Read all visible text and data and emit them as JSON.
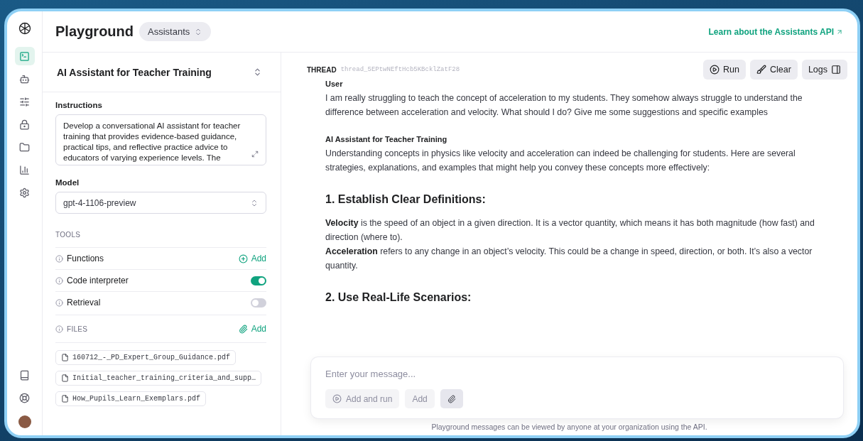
{
  "header": {
    "title": "Playground",
    "mode": "Assistants",
    "api_link": "Learn about the Assistants API"
  },
  "nav": [
    {
      "kind": "terminal",
      "selected": true
    },
    {
      "kind": "bot",
      "selected": false
    },
    {
      "kind": "sliders",
      "selected": false
    },
    {
      "kind": "lock",
      "selected": false
    },
    {
      "kind": "folder",
      "selected": false
    },
    {
      "kind": "chart",
      "selected": false
    },
    {
      "kind": "settings",
      "selected": false
    }
  ],
  "nav_bottom": [
    {
      "kind": "book"
    },
    {
      "kind": "help"
    },
    {
      "kind": "avatar"
    }
  ],
  "assistant": {
    "name": "AI Assistant for Teacher Training",
    "instructions_label": "Instructions",
    "instructions": "Develop a conversational AI assistant for teacher training that provides evidence-based guidance, practical tips, and reflective practice advice to educators of varying experience levels. The",
    "model_label": "Model",
    "model": "gpt-4-1106-preview",
    "tools_label": "TOOLS",
    "tools": [
      {
        "name": "Functions",
        "kind": "add",
        "action": "Add"
      },
      {
        "name": "Code interpreter",
        "kind": "toggle",
        "on": true
      },
      {
        "name": "Retrieval",
        "kind": "toggle",
        "on": false
      }
    ],
    "files_label": "FILES",
    "files_action": "Add",
    "files": [
      "160712_-_PD_Expert_Group_Guidance.pdf",
      "Initial_teacher_training_criteria_and_supp…",
      "How_Pupils_Learn_Exemplars.pdf"
    ]
  },
  "thread": {
    "label": "THREAD",
    "id": "thread_5EPtwNEftHcb5KBcklZatF28",
    "buttons": [
      {
        "kind": "run",
        "label": "Run"
      },
      {
        "kind": "clear",
        "label": "Clear"
      },
      {
        "kind": "logs",
        "label": "Logs"
      }
    ],
    "messages": [
      {
        "role": "User",
        "blocks": [
          {
            "kind": "p",
            "text": "I am really struggling to teach the concept of acceleration to my students. They somehow always struggle to understand the difference between acceleration and velocity. What should I do? Give me some suggestions and specific examples"
          }
        ]
      },
      {
        "role": "AI Assistant for Teacher Training",
        "blocks": [
          {
            "kind": "p",
            "text": "Understanding concepts in physics like velocity and acceleration can indeed be challenging for students. Here are several strategies, explanations, and examples that might help you convey these concepts more effectively:"
          },
          {
            "kind": "h",
            "text": "1. Establish Clear Definitions:"
          },
          {
            "kind": "p",
            "text": "**Velocity** is the speed of an object in a given direction. It is a vector quantity, which means it has both magnitude (how fast) and direction (where to)."
          },
          {
            "kind": "line",
            "text": "**Acceleration** refers to any change in an object’s velocity. This could be a change in speed, direction, or both. It’s also a vector quantity."
          },
          {
            "kind": "h",
            "text": "2. Use Real-Life Scenarios:"
          }
        ]
      }
    ]
  },
  "composer": {
    "placeholder": "Enter your message...",
    "buttons": [
      {
        "kind": "run",
        "label": "Add and run"
      },
      {
        "kind": "plain",
        "label": "Add"
      },
      {
        "kind": "attach"
      }
    ]
  },
  "footer": "Playground messages can be viewed by anyone at your organization using the API."
}
